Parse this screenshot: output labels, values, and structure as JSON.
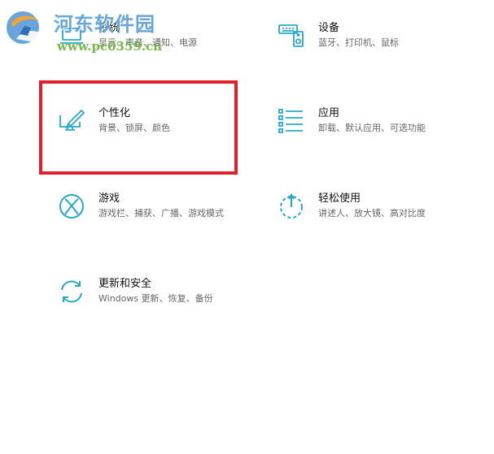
{
  "accent_color": "#27a9c6",
  "highlight_color": "#e0202a",
  "tiles": {
    "system": {
      "title": "系统",
      "desc": "显示、声音、通知、电源",
      "icon": "laptop-icon"
    },
    "devices": {
      "title": "设备",
      "desc": "蓝牙、打印机、鼠标",
      "icon": "keyboard-speaker-icon"
    },
    "personalization": {
      "title": "个性化",
      "desc": "背景、锁屏、颜色",
      "icon": "pen-monitor-icon"
    },
    "apps": {
      "title": "应用",
      "desc": "卸载、默认应用、可选功能",
      "icon": "apps-list-icon"
    },
    "gaming": {
      "title": "游戏",
      "desc": "游戏栏、捕获、广播、游戏模式",
      "icon": "xbox-icon"
    },
    "ease_of_access": {
      "title": "轻松使用",
      "desc": "讲述人、放大镜、高对比度",
      "icon": "timer-icon"
    },
    "update_security": {
      "title": "更新和安全",
      "desc": "Windows 更新、恢复、备份",
      "icon": "sync-icon"
    }
  },
  "watermark": {
    "title": "河东软件园",
    "url": "www.pc0359.cn"
  }
}
